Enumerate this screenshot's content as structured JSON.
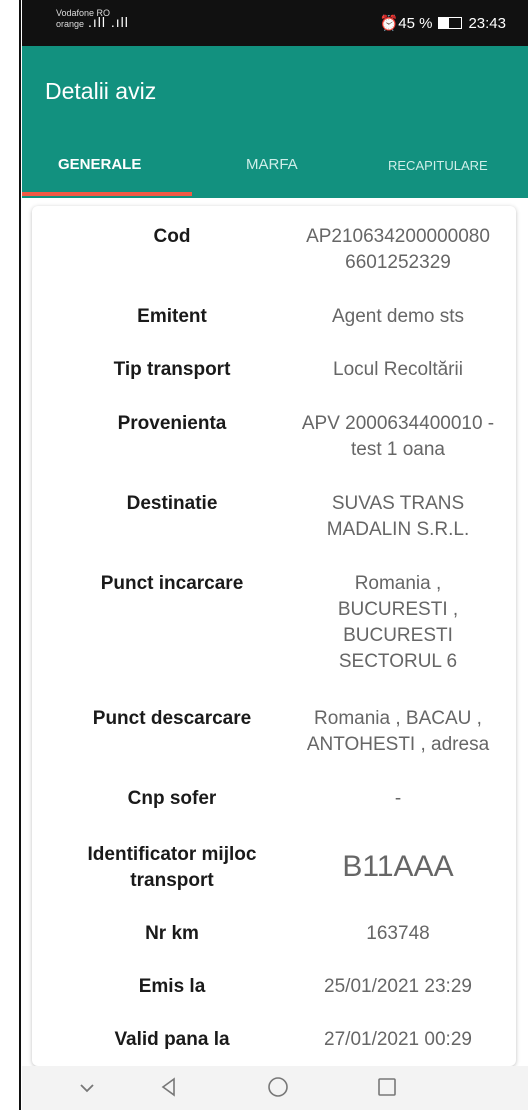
{
  "statusbar": {
    "carrier_line1": "Vodafone RO",
    "carrier_line2": "orange",
    "signal": ".ıll .ıll",
    "alarm_battery": "⏰45 %",
    "battery_level_percent": 45,
    "time": "23:43"
  },
  "appbar": {
    "title": "Detalii aviz",
    "tabs": [
      {
        "label": "GENERALE",
        "active": true
      },
      {
        "label": "MARFA",
        "active": false
      },
      {
        "label": "RECAPITULARE",
        "active": false
      }
    ],
    "accent_color": "#12917f",
    "indicator_color": "#f15a45"
  },
  "details": [
    {
      "label": "Cod",
      "value_lines": [
        "AP210634200000080",
        "6601252329"
      ]
    },
    {
      "label": "Emitent",
      "value_lines": [
        "Agent demo sts"
      ]
    },
    {
      "label": "Tip transport",
      "value_lines": [
        "Locul Recoltării"
      ]
    },
    {
      "label": "Provenienta",
      "value_lines": [
        "APV 2000634400010 -",
        "test 1 oana"
      ]
    },
    {
      "label": "Destinatie",
      "value_lines": [
        "SUVAS TRANS",
        "MADALIN S.R.L."
      ]
    },
    {
      "label": "Punct incarcare",
      "value_lines": [
        "Romania ,",
        "BUCURESTI ,",
        "BUCURESTI",
        "SECTORUL 6"
      ]
    },
    {
      "label": "Punct descarcare",
      "value_lines": [
        "Romania , BACAU ,",
        "ANTOHESTI , adresa"
      ]
    },
    {
      "label": "Cnp sofer",
      "value_lines": [
        "-"
      ]
    },
    {
      "label_lines": [
        "Identificator mijloc",
        "transport"
      ],
      "value_lines": [
        "B11AAA"
      ]
    },
    {
      "label": "Nr km",
      "value_lines": [
        "163748"
      ]
    },
    {
      "label": "Emis la",
      "value_lines": [
        "25/01/2021 23:29"
      ]
    },
    {
      "label": "Valid pana la",
      "value_lines": [
        "27/01/2021 00:29"
      ]
    }
  ],
  "navbar": {
    "icons": [
      "chevron-down-icon",
      "back-triangle-icon",
      "home-circle-icon",
      "recents-square-icon"
    ]
  }
}
